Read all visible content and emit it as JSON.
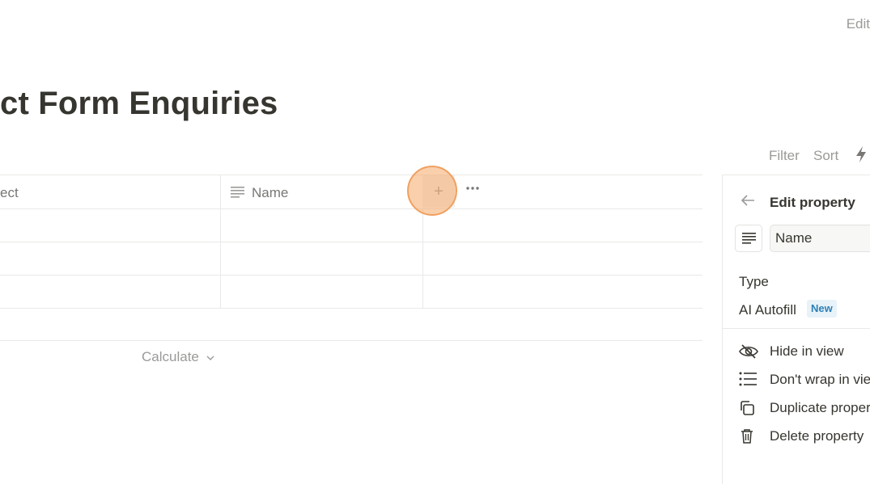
{
  "header": {
    "edit_label": "Edit"
  },
  "page": {
    "title": "ct Form Enquiries"
  },
  "toolbar": {
    "filter_label": "Filter",
    "sort_label": "Sort",
    "automation_icon": "bolt-icon"
  },
  "table": {
    "columns": [
      {
        "label": "ect",
        "icon": "none"
      },
      {
        "label": "Name",
        "icon": "text-lines-icon"
      }
    ],
    "add_column_icon": "plus-icon",
    "more_icon": "ellipsis-icon",
    "row_count": 3,
    "calculate_label": "Calculate"
  },
  "panel": {
    "title": "Edit property",
    "name_value": "Name",
    "type_label": "Type",
    "type_value": "AI Autofill",
    "badge": "New",
    "menu": [
      {
        "label": "Hide in view",
        "icon": "eye-slash-icon"
      },
      {
        "label": "Don't wrap in view",
        "icon": "list-icon"
      },
      {
        "label": "Duplicate property",
        "icon": "duplicate-icon"
      },
      {
        "label": "Delete property",
        "icon": "trash-icon"
      }
    ]
  },
  "colors": {
    "text": "#37352f",
    "muted": "#9b9a97",
    "border": "#e9e9e7",
    "highlight": "#f6a868",
    "badge_bg": "#e7f3f8",
    "badge_text": "#2e7fb8"
  }
}
